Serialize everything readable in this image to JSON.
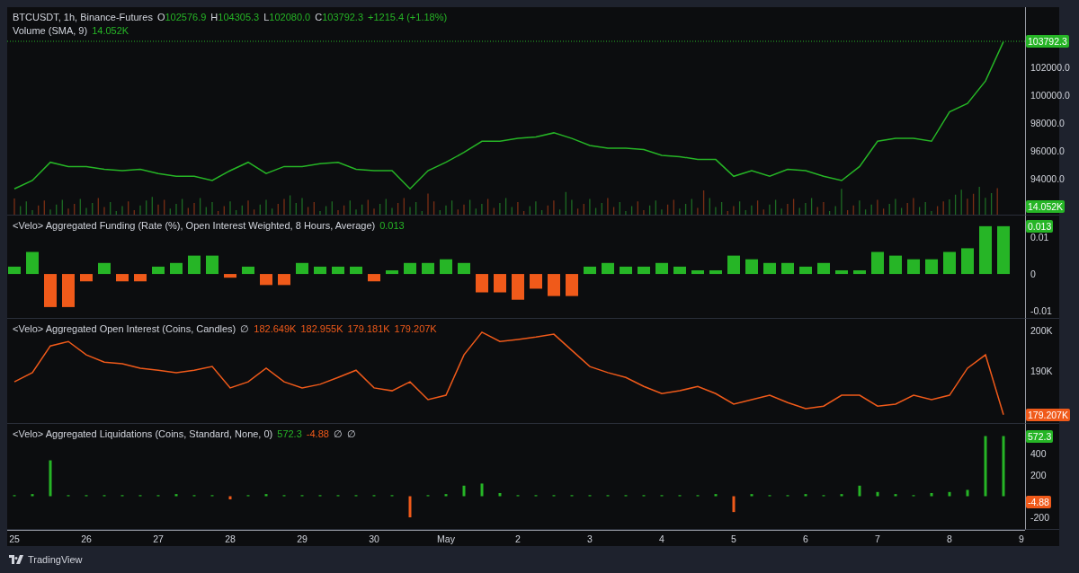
{
  "price_pane": {
    "legend": {
      "symbol": "BTCUSDT, 1h, Binance-Futures",
      "ohlc": [
        {
          "label": "O",
          "value": "102576.9"
        },
        {
          "label": "H",
          "value": "104305.3"
        },
        {
          "label": "L",
          "value": "102080.0"
        },
        {
          "label": "C",
          "value": "103792.3"
        }
      ],
      "change": "+1215.4 (+1.18%)"
    },
    "volume_legend": {
      "label": "Volume (SMA, 9)",
      "value": "14.052K"
    },
    "last_price_label": "103792.3",
    "volume_label": "14.052K",
    "chart_data": {
      "type": "line",
      "ylim": [
        91400,
        106260
      ],
      "yticks": [
        {
          "value": 94000,
          "label": "94000.0"
        },
        {
          "value": 96000,
          "label": "96000.0"
        },
        {
          "value": 98000,
          "label": "98000.0"
        },
        {
          "value": 100000,
          "label": "100000.0"
        },
        {
          "value": 102000,
          "label": "102000.0"
        }
      ],
      "series": [
        {
          "color": "#26b526",
          "values": [
            93300,
            93900,
            95200,
            94900,
            94900,
            94700,
            94600,
            94700,
            94400,
            94200,
            94200,
            93900,
            94600,
            95200,
            94400,
            94900,
            94900,
            95100,
            95200,
            94700,
            94600,
            94600,
            93300,
            94600,
            95200,
            95900,
            96700,
            96700,
            96900,
            97000,
            97300,
            96900,
            96400,
            96200,
            96200,
            96100,
            95700,
            95600,
            95400,
            95400,
            94200,
            94600,
            94200,
            94700,
            94600,
            94200,
            93900,
            94900,
            96700,
            96900,
            96900,
            96700,
            98800,
            99400,
            101000,
            103800,
            null
          ]
        }
      ]
    }
  },
  "funding_pane": {
    "legend": {
      "title": "<Velo> Aggregated Funding (Rate (%), Open Interest Weighted, 8 Hours, Average)",
      "value": "0.013"
    },
    "value_label": "0.013",
    "chart_data": {
      "type": "bar",
      "ylim": [
        -0.0122,
        0.0159
      ],
      "yticks": [
        {
          "value": -0.01,
          "label": "-0.01"
        },
        {
          "value": 0,
          "label": "0"
        },
        {
          "value": 0.01,
          "label": "0.01"
        }
      ],
      "values": [
        0.002,
        0.006,
        -0.009,
        -0.009,
        -0.002,
        0.003,
        -0.002,
        -0.002,
        0.002,
        0.003,
        0.005,
        0.005,
        -0.001,
        0.002,
        -0.003,
        -0.003,
        0.003,
        0.002,
        0.002,
        0.002,
        -0.002,
        0.001,
        0.003,
        0.003,
        0.004,
        0.003,
        -0.005,
        -0.005,
        -0.007,
        -0.004,
        -0.006,
        -0.006,
        0.002,
        0.003,
        0.002,
        0.002,
        0.003,
        0.002,
        0.001,
        0.001,
        0.005,
        0.004,
        0.003,
        0.003,
        0.002,
        0.003,
        0.001,
        0.001,
        0.006,
        0.005,
        0.004,
        0.004,
        0.006,
        0.007,
        0.013,
        0.013,
        null
      ]
    }
  },
  "open_interest_pane": {
    "legend": {
      "title": "<Velo> Aggregated Open Interest (Coins, Candles)",
      "symbol": "∅",
      "values": [
        "182.649K",
        "182.955K",
        "179.181K",
        "179.207K"
      ]
    },
    "value_label": "179.207K",
    "chart_data": {
      "type": "line",
      "ylim": [
        176.9,
        202.9
      ],
      "yticks": [
        {
          "value": 190,
          "label": "190K"
        },
        {
          "value": 200,
          "label": "200K"
        }
      ],
      "series": [
        {
          "color": "#f05a1a",
          "values": [
            187.3,
            189.6,
            196.2,
            197.3,
            194,
            192.2,
            191.8,
            190.7,
            190.2,
            189.6,
            190.2,
            191.1,
            185.8,
            187.3,
            190.7,
            187.3,
            185.8,
            186.7,
            188.4,
            190.2,
            185.8,
            185.1,
            187.3,
            182.9,
            184,
            194,
            199.6,
            197.3,
            197.8,
            198.4,
            199.1,
            195.1,
            191.1,
            189.6,
            188.4,
            186.2,
            184.4,
            185.1,
            186.2,
            184.4,
            181.8,
            182.9,
            184,
            182.2,
            180.7,
            181.3,
            184,
            184,
            181.3,
            181.8,
            184,
            182.9,
            184,
            190.7,
            194,
            179.2,
            null
          ]
        }
      ]
    }
  },
  "liquidations_pane": {
    "legend": {
      "title": "<Velo> Aggregated Liquidations (Coins, Standard, None, 0)",
      "values": [
        {
          "text": "572.3",
          "kind": "up"
        },
        {
          "text": "-4.88",
          "kind": "down"
        }
      ],
      "symbols": [
        "∅",
        "∅"
      ]
    },
    "value_labels": [
      {
        "text": "572.3",
        "kind": "up"
      },
      {
        "text": "-4.88",
        "kind": "down"
      }
    ],
    "chart_data": {
      "type": "bar",
      "ylim": [
        -319,
        685
      ],
      "yticks": [
        {
          "value": -200,
          "label": "-200"
        },
        {
          "value": 200,
          "label": "200"
        },
        {
          "value": 400,
          "label": "400"
        }
      ],
      "categories": [
        "25",
        null,
        null,
        null,
        "26",
        null,
        null,
        null,
        "27",
        null,
        null,
        null,
        "28",
        null,
        null,
        null,
        "29",
        null,
        null,
        null,
        "30",
        null,
        null,
        null,
        "May",
        null,
        null,
        null,
        "2",
        null,
        null,
        null,
        "3",
        null,
        null,
        null,
        "4",
        null,
        null,
        null,
        "5",
        null,
        null,
        null,
        "6",
        null,
        null,
        null,
        "7",
        null,
        null,
        null,
        "8",
        null,
        null,
        null,
        "9"
      ],
      "values": [
        10,
        20,
        340,
        10,
        10,
        10,
        10,
        10,
        10,
        20,
        10,
        10,
        -30,
        10,
        20,
        10,
        10,
        10,
        10,
        10,
        10,
        10,
        -200,
        10,
        20,
        100,
        120,
        30,
        10,
        10,
        10,
        10,
        10,
        10,
        10,
        10,
        10,
        10,
        10,
        20,
        -150,
        20,
        10,
        10,
        20,
        10,
        20,
        100,
        40,
        20,
        10,
        30,
        40,
        60,
        570,
        570,
        null
      ]
    }
  },
  "footer": {
    "brand": "TradingView"
  }
}
